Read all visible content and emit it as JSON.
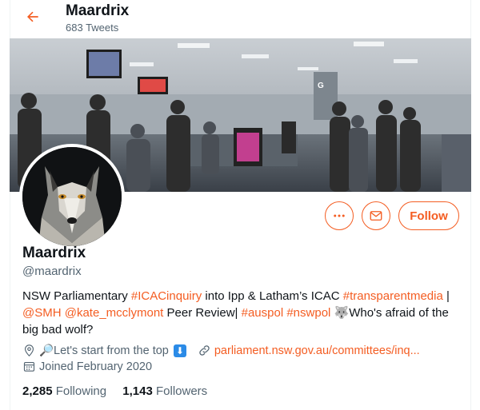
{
  "header": {
    "name": "Maardrix",
    "tweet_count": "683 Tweets"
  },
  "profile": {
    "name": "Maardrix",
    "handle": "@maardrix",
    "bio": {
      "line1": [
        {
          "text": "NSW Parliamentary ",
          "tag": false
        },
        {
          "text": "#ICACinquiry",
          "tag": true
        },
        {
          "text": " into Ipp & Latham’s ICAC ",
          "tag": false
        },
        {
          "text": "#transparentmedia",
          "tag": true
        },
        {
          "text": " |",
          "tag": false
        }
      ],
      "line2": [
        {
          "text": "@SMH",
          "tag": true
        },
        {
          "text": " ",
          "tag": false
        },
        {
          "text": "@kate_mcclymont",
          "tag": true
        },
        {
          "text": " Peer Review| ",
          "tag": false
        },
        {
          "text": "#auspol",
          "tag": true
        },
        {
          "text": " ",
          "tag": false
        },
        {
          "text": "#nswpol",
          "tag": true
        },
        {
          "text": " 🐺Who's afraid of the",
          "tag": false
        }
      ],
      "line3": "big bad wolf?"
    },
    "location": "🔎Let's start from the top",
    "location_emoji": "⬇",
    "website": "parliament.nsw.gov.au/committees/inq...",
    "joined": "Joined February 2020",
    "following_count": "2,285",
    "following_label": "Following",
    "followers_count": "1,143",
    "followers_label": "Followers"
  },
  "actions": {
    "follow_label": "Follow",
    "more_icon": "more-icon",
    "message_icon": "mail-icon"
  },
  "colors": {
    "accent": "#f45d22",
    "muted": "#536471",
    "text": "#0f1419"
  }
}
